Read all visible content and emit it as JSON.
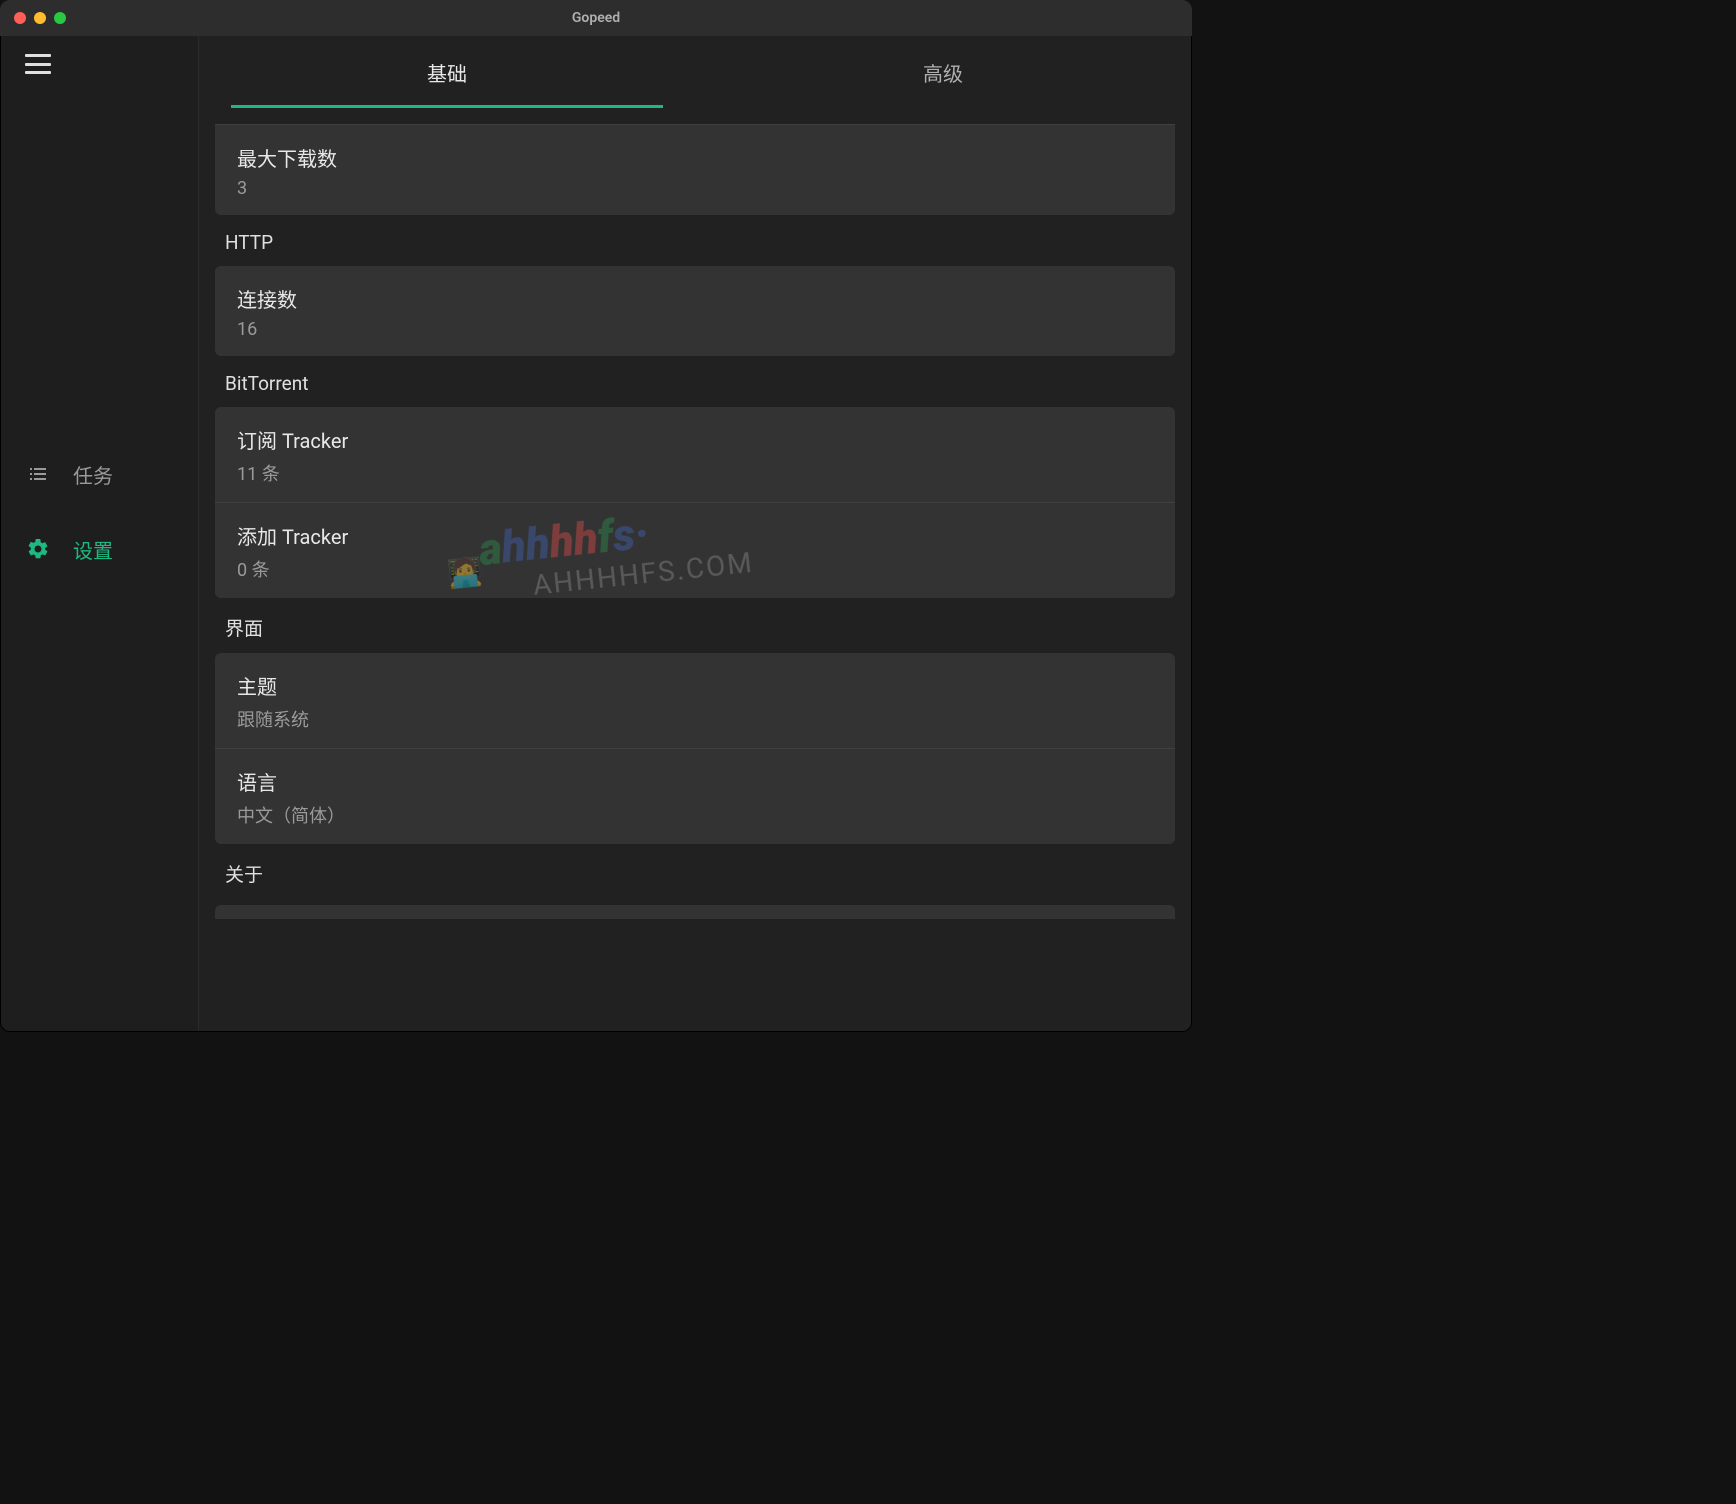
{
  "window": {
    "title": "Gopeed"
  },
  "sidebar": {
    "items": [
      {
        "label": "任务"
      },
      {
        "label": "设置"
      }
    ]
  },
  "tabs": [
    {
      "label": "基础"
    },
    {
      "label": "高级"
    }
  ],
  "sections": {
    "general": {
      "max_downloads": {
        "label": "最大下载数",
        "value": "3"
      }
    },
    "http": {
      "header": "HTTP",
      "connections": {
        "label": "连接数",
        "value": "16"
      }
    },
    "bittorrent": {
      "header": "BitTorrent",
      "subscribe_tracker": {
        "label": "订阅 Tracker",
        "value": "11 条"
      },
      "add_tracker": {
        "label": "添加 Tracker",
        "value": "0 条"
      }
    },
    "ui": {
      "header": "界面",
      "theme": {
        "label": "主题",
        "value": "跟随系统"
      },
      "language": {
        "label": "语言",
        "value": "中文（简体）"
      }
    },
    "about": {
      "header": "关于"
    }
  },
  "watermark": {
    "line1": "ahhhhfs",
    "line2": "AHHHHFS.COM"
  }
}
